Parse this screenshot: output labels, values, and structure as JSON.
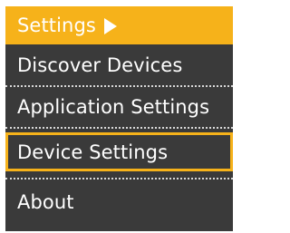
{
  "menu": {
    "header_label": "Settings",
    "items": [
      {
        "label": "Discover Devices"
      },
      {
        "label": "Application Settings"
      },
      {
        "label": "Device Settings"
      },
      {
        "label": "About"
      }
    ],
    "selected_index": 2
  },
  "colors": {
    "accent": "#f6b21a",
    "background": "#3a3a3a",
    "text": "#ffffff",
    "separator": "#d8d8d8"
  },
  "icons": {
    "header_arrow": "play-arrow-icon"
  }
}
